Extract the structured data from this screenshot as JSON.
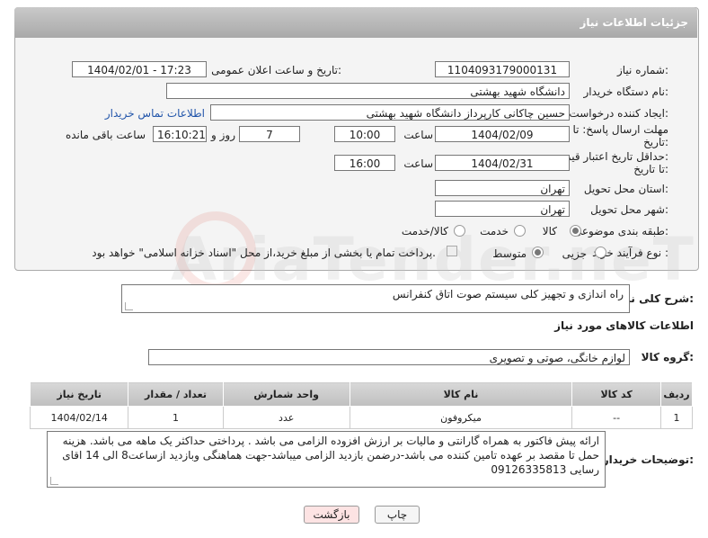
{
  "header": {
    "title": "جزئیات اطلاعات نیاز"
  },
  "form": {
    "need_number_label": "شماره نیاز:",
    "need_number": "1104093179000131",
    "announce_label": "تاریخ و ساعت اعلان عمومی:",
    "announce_value": "1404/02/01 - 17:23",
    "buyer_org_label": "نام دستگاه خریدار:",
    "buyer_org": "دانشگاه شهید بهشتی",
    "requester_label": "ایجاد کننده درخواست:",
    "requester": "حسین چاکانی کارپرداز دانشگاه شهید بهشتی",
    "contact_link": "اطلاعات تماس خریدار",
    "deadline_label_1": "مهلت ارسال پاسخ: تا",
    "deadline_label_2": "تاریخ:",
    "deadline_date": "1404/02/09",
    "time_label": "ساعت",
    "deadline_time": "10:00",
    "days_value": "7",
    "days_label": "روز و",
    "remaining_time": "16:10:21",
    "remaining_label": "ساعت باقی مانده",
    "validity_label_1": "حداقل تاریخ اعتبار قیمت:",
    "validity_label_2": "تا تاریخ:",
    "validity_date": "1404/02/31",
    "validity_time": "16:00",
    "province_label": "استان محل تحویل:",
    "province": "تهران",
    "city_label": "شهر محل تحویل:",
    "city": "تهران",
    "category_label": "طبقه بندی موضوعی:",
    "category_options": [
      "کالا",
      "خدمت",
      "کالا/خدمت"
    ],
    "process_label": "نوع فرآیند خرید :",
    "process_options": [
      "جزیی",
      "متوسط"
    ],
    "payment_note": "پرداخت تمام یا بخشی از مبلغ خرید،از محل \"اسناد خزانه اسلامی\" خواهد بود."
  },
  "description": {
    "label": "شرح کلی نیاز:",
    "value": "راه اندازی و تجهیز کلی سیستم صوت اتاق کنفرانس"
  },
  "goods": {
    "section_title": "اطلاعات کالاهای مورد نیاز",
    "group_label": "گروه کالا:",
    "group_value": "لوازم خانگی، صوتی و تصویری",
    "columns": [
      "ردیف",
      "کد کالا",
      "نام کالا",
      "واحد شمارش",
      "تعداد / مقدار",
      "تاریخ نیاز"
    ],
    "rows": [
      {
        "row": "1",
        "code": "--",
        "name": "میکروفون",
        "unit": "عدد",
        "qty": "1",
        "date": "1404/02/14"
      }
    ]
  },
  "buyer_notes": {
    "label": "توضیحات خریدار:",
    "value": "ارائه پیش فاکتور به همراه گارانتی و مالیات بر ارزش افزوده الزامی می باشد . پرداختی حداکثر یک ماهه می باشد. هزینه حمل تا مقصد بر عهده تامین کننده می باشد-درضمن بازدید الزامی میباشد-جهت هماهنگی وبازدید ازساعت8 الی 14 اقای رسایی 09126335813"
  },
  "buttons": {
    "print": "چاپ",
    "back": "بازگشت"
  },
  "colors": {
    "header_bg": "#b3b3b3",
    "link": "#2255aa",
    "back_button_bg": "#fde3e3"
  }
}
